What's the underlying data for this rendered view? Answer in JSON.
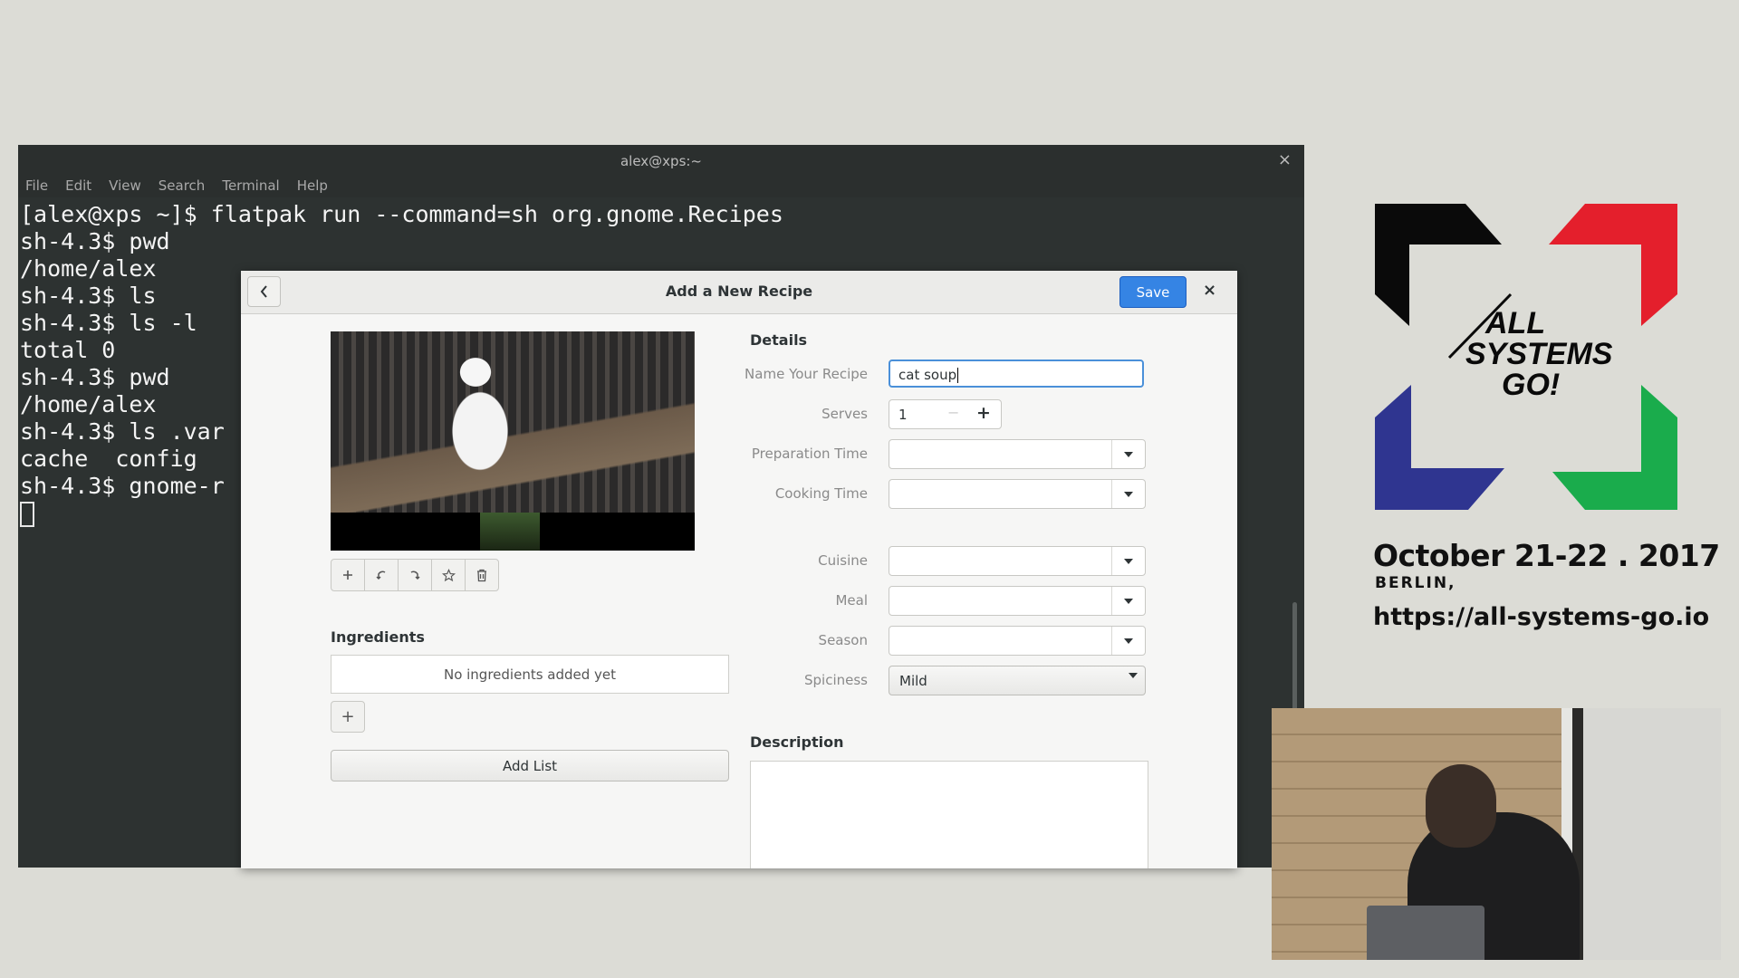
{
  "terminal": {
    "title": "alex@xps:~",
    "close_glyph": "×",
    "menu": [
      "File",
      "Edit",
      "View",
      "Search",
      "Terminal",
      "Help"
    ],
    "lines": [
      "[alex@xps ~]$ flatpak run --command=sh org.gnome.Recipes",
      "sh-4.3$ pwd",
      "/home/alex",
      "sh-4.3$ ls",
      "sh-4.3$ ls -l",
      "total 0",
      "sh-4.3$ pwd",
      "/home/alex",
      "sh-4.3$ ls .var",
      "cache  config",
      "sh-4.3$ gnome-r"
    ]
  },
  "dialog": {
    "title": "Add a New Recipe",
    "save_label": "Save",
    "close_glyph": "×",
    "image_toolbar_icons": [
      "add-icon",
      "rotate-left-icon",
      "rotate-right-icon",
      "star-icon",
      "trash-icon"
    ],
    "ingredients": {
      "title": "Ingredients",
      "empty_text": "No ingredients added yet",
      "add_glyph": "+",
      "add_list_label": "Add List"
    },
    "details": {
      "title": "Details",
      "name_label": "Name Your Recipe",
      "name_value": "cat soup",
      "serves_label": "Serves",
      "serves_value": "1",
      "serves_minus": "−",
      "serves_plus": "+",
      "prep_label": "Preparation Time",
      "cooking_label": "Cooking Time",
      "cuisine_label": "Cuisine",
      "meal_label": "Meal",
      "season_label": "Season",
      "spiciness_label": "Spiciness",
      "spiciness_value": "Mild"
    },
    "description_title": "Description"
  },
  "branding": {
    "logo_text_1": "ALL",
    "logo_text_2": "SYSTEMS",
    "logo_text_3": "GO!",
    "date": "October 21-22 . 2017",
    "city": "BERLIN,",
    "url": "https://all-systems-go.io",
    "colors": {
      "black": "#0a0a0a",
      "red": "#e41f2c",
      "blue": "#2f3590",
      "green": "#1aac4c"
    }
  }
}
